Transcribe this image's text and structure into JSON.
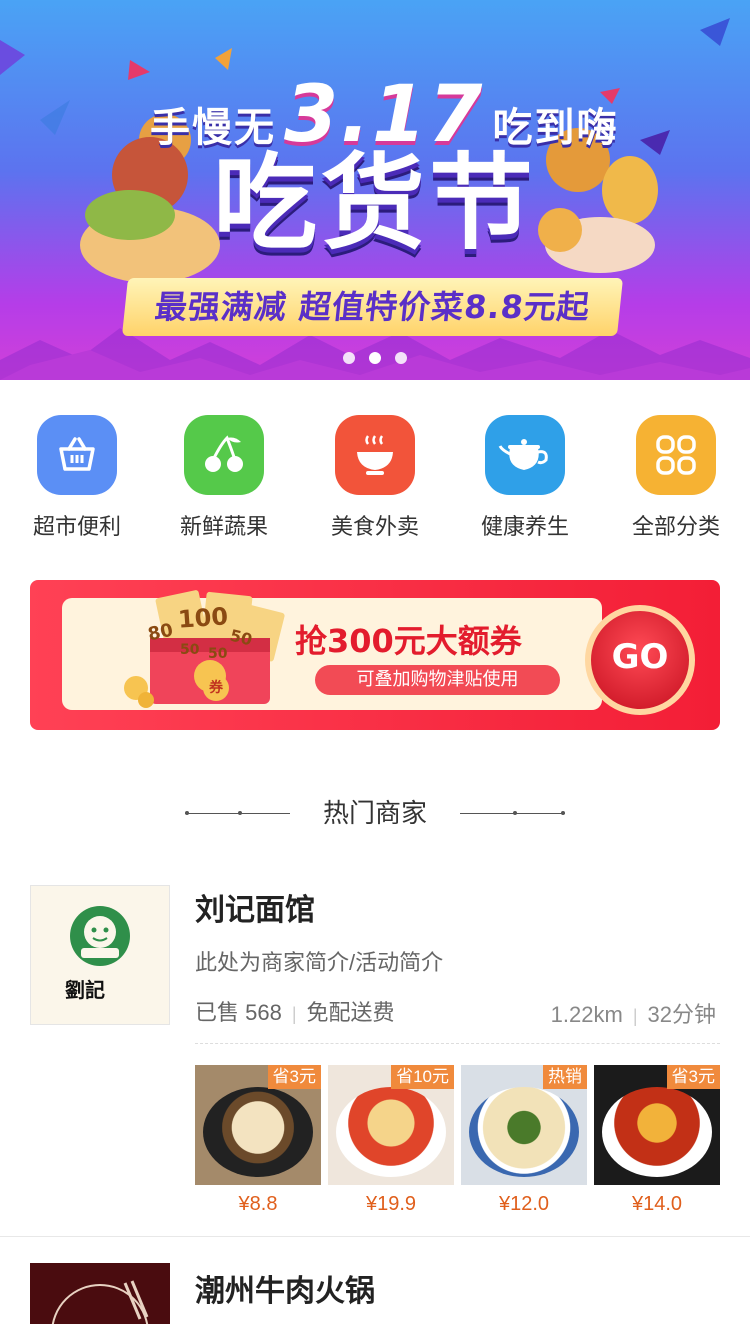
{
  "banner": {
    "line1_left": "手慢无",
    "line1_big": "3.17",
    "line1_right": "吃到嗨",
    "title": "吃货节",
    "subtitle": "最强满减 超值特价菜8.8元起",
    "dots_count": 3,
    "colors": {
      "top": "#4aa3f5",
      "bottom": "#d240d8"
    }
  },
  "categories": [
    {
      "label": "超市便利",
      "icon": "basket-icon",
      "color": "#5b8ff5"
    },
    {
      "label": "新鲜蔬果",
      "icon": "cherry-icon",
      "color": "#55c94a"
    },
    {
      "label": "美食外卖",
      "icon": "bowl-icon",
      "color": "#f2543a"
    },
    {
      "label": "健康养生",
      "icon": "teapot-icon",
      "color": "#2fa0e8"
    },
    {
      "label": "全部分类",
      "icon": "grid-icon",
      "color": "#f6b233"
    }
  ],
  "coupon": {
    "title": "抢300元大额券",
    "subtitle": "可叠加购物津贴使用",
    "go_label": "GO",
    "bills": [
      "100",
      "80",
      "50",
      "50",
      "50"
    ],
    "stamp": "券"
  },
  "section": {
    "title": "热门商家"
  },
  "merchants": [
    {
      "name": "刘记面馆",
      "logo_text": "劉記",
      "desc": "此处为商家简介/活动简介",
      "sold": "已售 568",
      "delivery": "免配送费",
      "distance": "1.22km",
      "time": "32分钟",
      "dishes": [
        {
          "tag": "省3元",
          "price": "¥8.8"
        },
        {
          "tag": "省10元",
          "price": "¥19.9"
        },
        {
          "tag": "热销",
          "price": "¥12.0"
        },
        {
          "tag": "省3元",
          "price": "¥14.0"
        }
      ]
    },
    {
      "name": "潮州牛肉火锅"
    }
  ]
}
